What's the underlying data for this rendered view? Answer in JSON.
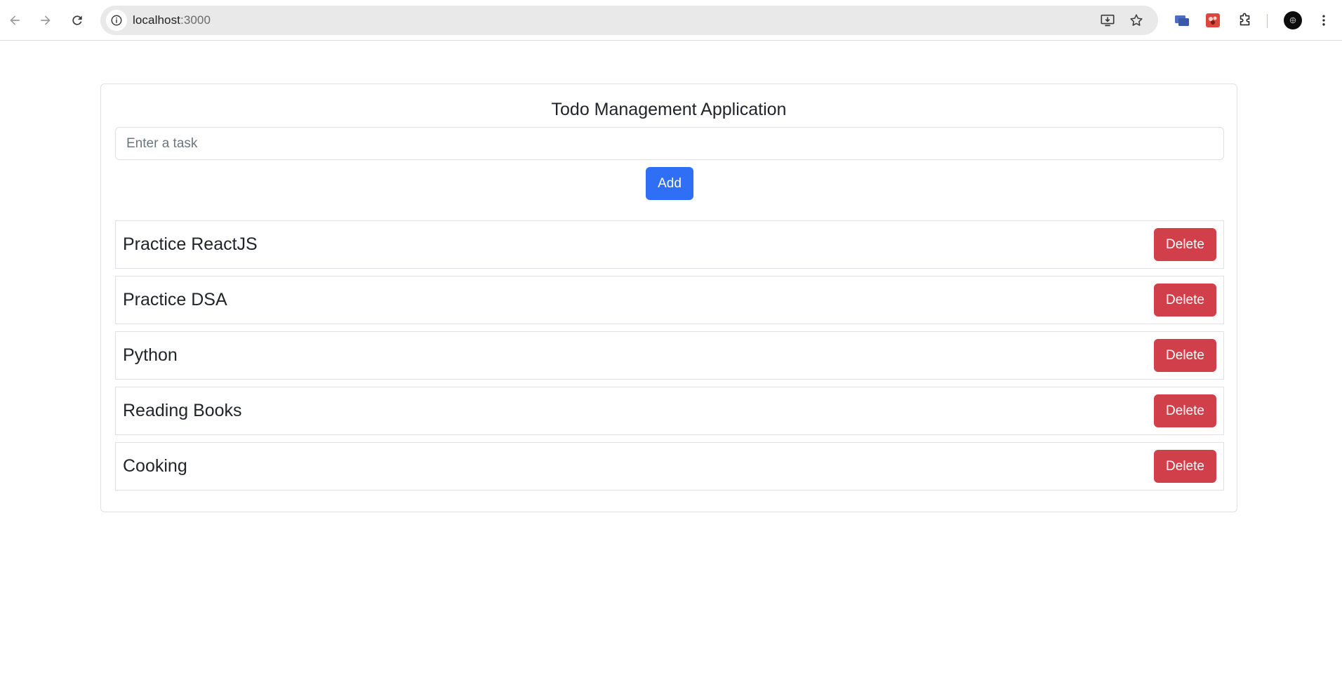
{
  "browser": {
    "url_host": "localhost",
    "url_port": ":3000",
    "icons": {
      "back": "arrow-left-icon",
      "forward": "arrow-right-icon",
      "reload": "reload-icon",
      "site_info": "info-icon",
      "install": "install-app-icon",
      "bookmark": "star-icon",
      "extensions": "puzzle-icon",
      "menu": "kebab-menu-icon"
    }
  },
  "app": {
    "title": "Todo Management Application",
    "input_placeholder": "Enter a task",
    "input_value": "",
    "add_label": "Add",
    "delete_label": "Delete",
    "todos": [
      {
        "text": "Practice ReactJS"
      },
      {
        "text": "Practice DSA"
      },
      {
        "text": "Python"
      },
      {
        "text": "Reading Books"
      },
      {
        "text": "Cooking"
      }
    ]
  },
  "colors": {
    "add_button": "#2f6ff5",
    "delete_button": "#d03f4a"
  }
}
